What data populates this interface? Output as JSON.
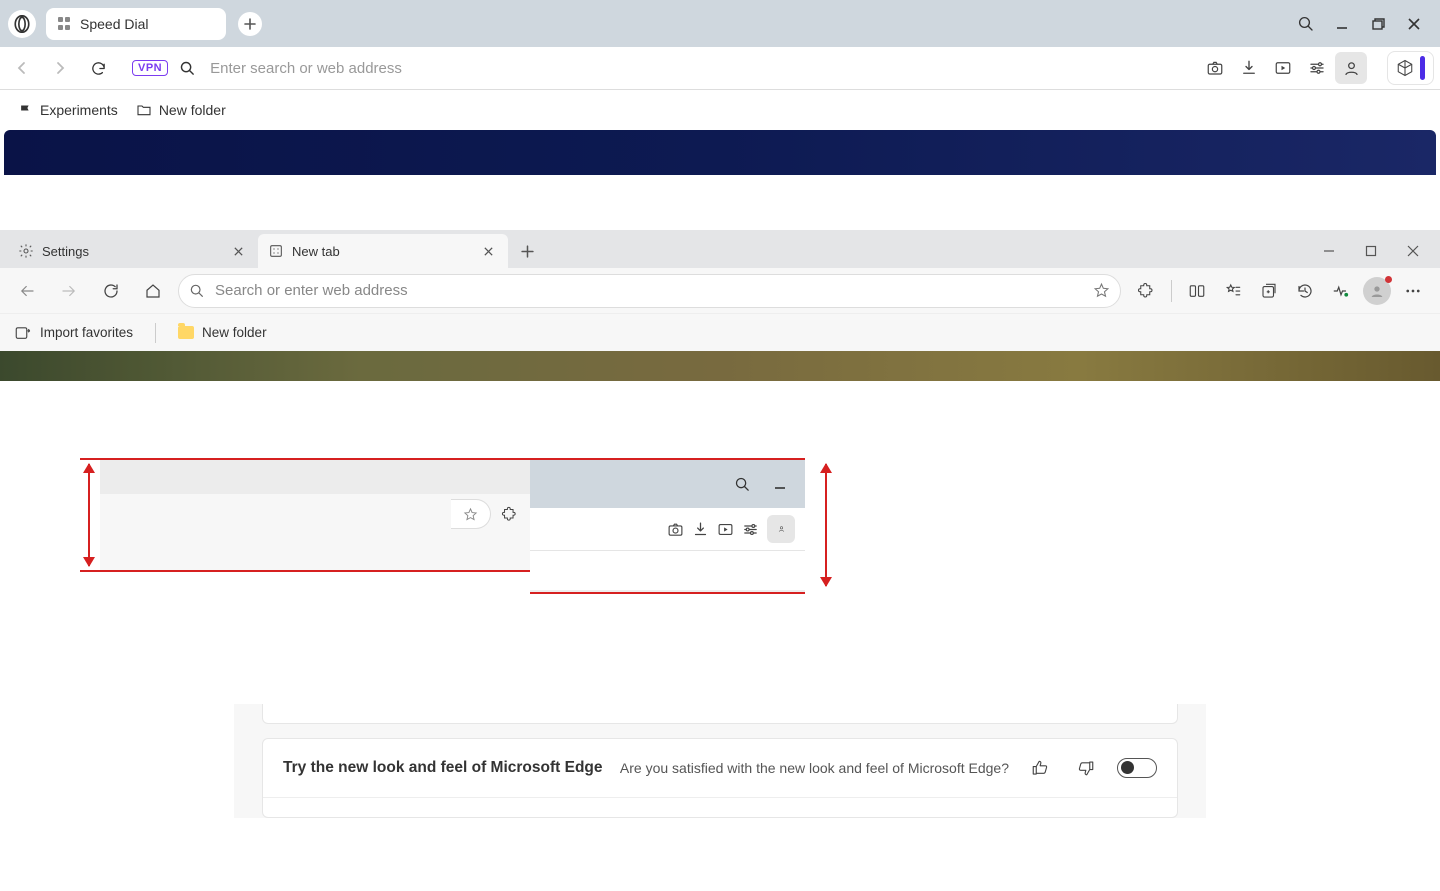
{
  "opera": {
    "tab_title": "Speed Dial",
    "vpn_label": "VPN",
    "address_placeholder": "Enter search or web address",
    "bookmarks": {
      "experiments": "Experiments",
      "new_folder": "New folder"
    }
  },
  "edge": {
    "tabs": {
      "settings": "Settings",
      "new_tab": "New tab"
    },
    "omnibox_placeholder": "Search or enter web address",
    "favbar": {
      "import": "Import favorites",
      "new_folder": "New folder"
    }
  },
  "settings": {
    "row_title": "Try the new look and feel of Microsoft Edge",
    "row_question": "Are you satisfied with the new look and feel of Microsoft Edge?"
  }
}
